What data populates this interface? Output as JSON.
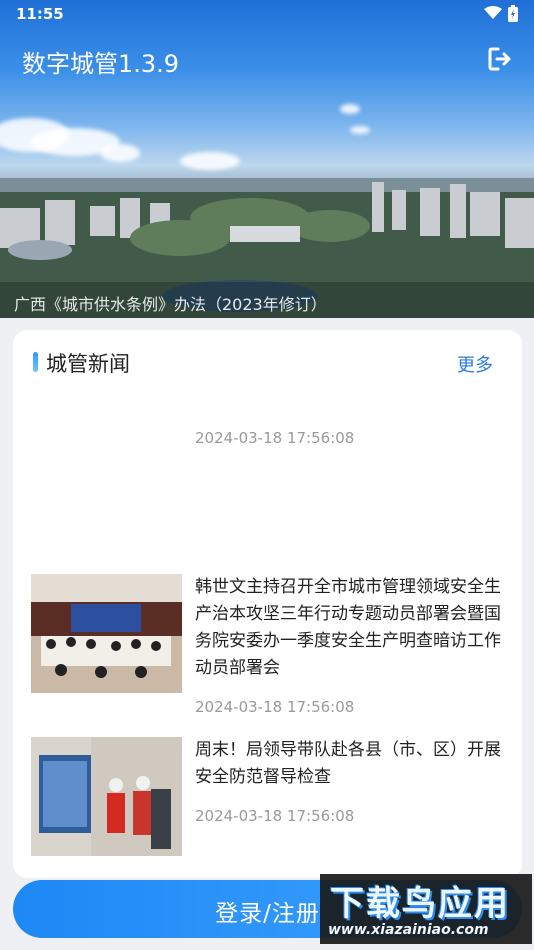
{
  "status_bar": {
    "time": "11:55"
  },
  "header": {
    "title": "数字城管1.3.9",
    "logout_icon": "logout-icon"
  },
  "banner": {
    "caption": "广西《城市供水条例》办法（2023年修订）"
  },
  "news_section": {
    "title": "城管新闻",
    "more_label": "更多",
    "first_date": "2024-03-18 17:56:08",
    "items": [
      {
        "title": "韩世文主持召开全市城市管理领域安全生产治本攻坚三年行动专题动员部署会暨国务院安委办一季度安全生产明查暗访工作动员部署会",
        "date": "2024-03-18 17:56:08"
      },
      {
        "title": "周末！局领导带队赴各县（市、区）开展安全防范督导检查",
        "date": "2024-03-18 17:56:08"
      }
    ]
  },
  "login": {
    "label": "登录/注册"
  },
  "watermark": {
    "logo": "下载鸟应用",
    "url": "www.xiazainiao.com"
  },
  "colors": {
    "accent": "#2a7be4",
    "button": "#1e88f5"
  }
}
